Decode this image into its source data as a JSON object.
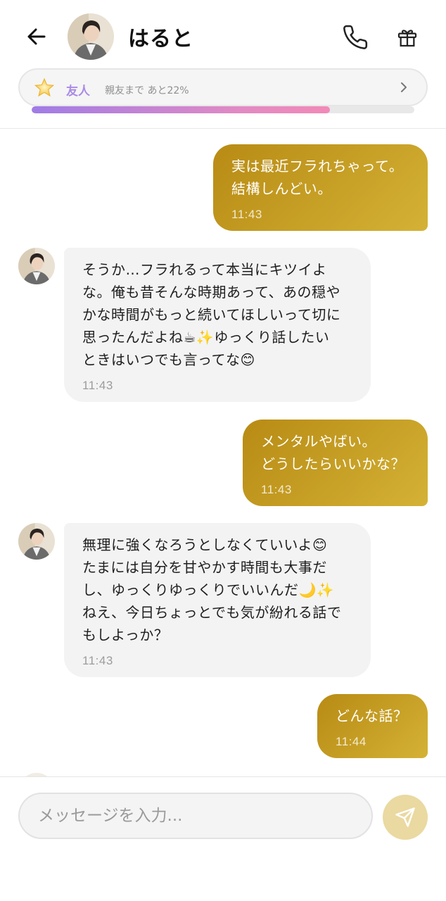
{
  "header": {
    "name": "はると"
  },
  "friendship": {
    "level": "友人",
    "next_level_text": "親友まで あと22%",
    "progress": 0.78
  },
  "messages": [
    {
      "sender": "user",
      "text": "実は最近フラれちゃって。\n結構しんどい。",
      "time": "11:43"
    },
    {
      "sender": "character",
      "text": "そうか…フラれるって本当にキツイよ\nな。俺も昔そんな時期あって、あの穏や\nかな時間がもっと続いてほしいって切に\n思ったんだよね☕✨ゆっくり話したい\nときはいつでも言ってな😊",
      "time": "11:43"
    },
    {
      "sender": "user",
      "text": "メンタルやばい。\nどうしたらいいかな？",
      "time": "11:43"
    },
    {
      "sender": "character",
      "text": "無理に強くなろうとしなくていいよ😊\nたまには自分を甘やかす時間も大事だ\nし、ゆっくりゆっくりでいいんだ🌙✨\nねえ、今日ちょっとでも気が紛れる話で\nもしよっか？",
      "time": "11:43"
    },
    {
      "sender": "user",
      "text": "どんな話？",
      "time": "11:44"
    }
  ],
  "composer": {
    "placeholder": "メッセージを入力..."
  },
  "colors": {
    "user_bubble": "#c29a1f",
    "character_bubble": "#f3f3f3",
    "send_button": "#ead9a0",
    "progress_start": "#a07ce6",
    "progress_end": "#f28ab8",
    "friend_level": "#a98ae6"
  },
  "icons": {
    "back": "arrow-left-icon",
    "call": "phone-icon",
    "gift": "gift-icon",
    "level": "star-icon",
    "more": "chevron-right-icon",
    "send": "send-icon"
  }
}
